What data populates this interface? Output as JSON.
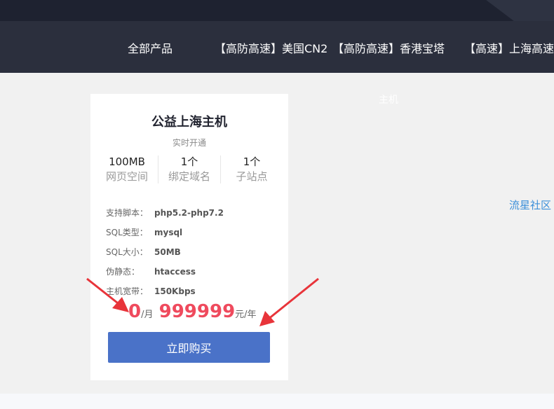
{
  "nav": {
    "items": [
      "全部产品",
      "【高防高速】美国CN2",
      "【高防高速】香港宝塔",
      "【高速】上海高速"
    ]
  },
  "floating_text": "主机",
  "side_link": "流星社区",
  "card": {
    "title": "公益上海主机",
    "subtitle": "实时开通",
    "stats": [
      {
        "value": "100MB",
        "label": "网页空间"
      },
      {
        "value": "1个",
        "label": "绑定域名"
      },
      {
        "value": "1个",
        "label": "子站点"
      }
    ],
    "specs": [
      {
        "key": "支持脚本：",
        "value": "php5.2-php7.2"
      },
      {
        "key": "SQL类型：",
        "value": "mysql"
      },
      {
        "key": "SQL大小：",
        "value": "50MB"
      },
      {
        "key": "伪静态：",
        "value": "htaccess"
      },
      {
        "key": "主机宽带：",
        "value": "150Kbps"
      }
    ],
    "price": {
      "monthly_value": "0",
      "monthly_unit": "/月",
      "yearly_value": "999999",
      "yearly_unit": "元/年"
    },
    "buy_label": "立即购买"
  },
  "colors": {
    "nav_bg": "#2b2f3d",
    "topbar_bg": "#1e2230",
    "price_red": "#ef4a5d",
    "button_blue": "#4a72c8",
    "link_blue": "#3b8fd9",
    "arrow_red": "#e8343a"
  }
}
